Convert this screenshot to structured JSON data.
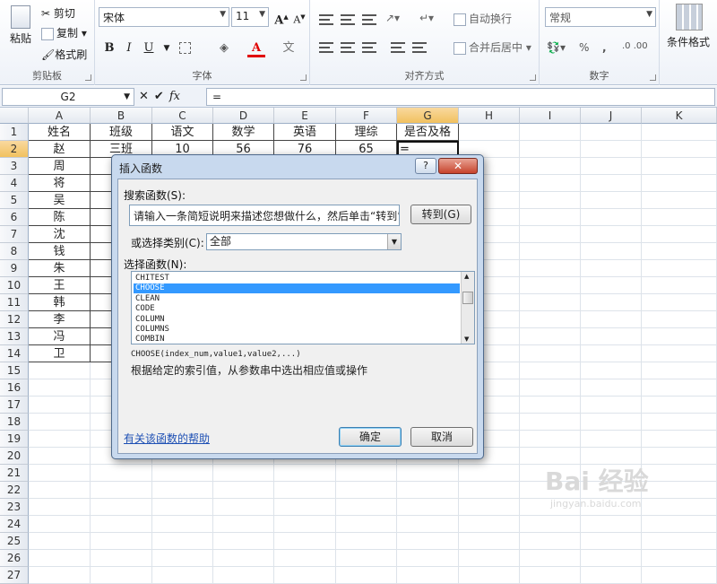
{
  "ribbon": {
    "clipboard": {
      "paste": "粘贴",
      "cut": "剪切",
      "copy": "复制",
      "format_painter": "格式刷",
      "group_label": "剪贴板"
    },
    "font": {
      "font_name": "宋体",
      "font_size": "11",
      "grow": "A",
      "shrink": "A",
      "bold": "B",
      "italic": "I",
      "underline": "U",
      "group_label": "字体"
    },
    "alignment": {
      "wrap": "自动换行",
      "merge": "合并后居中",
      "group_label": "对齐方式"
    },
    "number": {
      "format": "常规",
      "percent": "%",
      "comma": ",",
      "group_label": "数字"
    },
    "styles": {
      "conditional": "条件格式"
    }
  },
  "formula_bar": {
    "name_box": "G2",
    "cancel": "✕",
    "enter": "✔",
    "fx": "fx",
    "formula": "="
  },
  "sheet": {
    "columns": [
      "A",
      "B",
      "C",
      "D",
      "E",
      "F",
      "G",
      "H",
      "I",
      "J",
      "K"
    ],
    "rows": [
      "1",
      "2",
      "3",
      "4",
      "5",
      "6",
      "7",
      "8",
      "9",
      "10",
      "11",
      "12",
      "13",
      "14",
      "15",
      "16",
      "17",
      "18",
      "19",
      "20",
      "21",
      "22",
      "23",
      "24",
      "25",
      "26",
      "27"
    ],
    "headers": [
      "姓名",
      "班级",
      "语文",
      "数学",
      "英语",
      "理综",
      "是否及格"
    ],
    "row2": [
      "赵",
      "三班",
      "10",
      "56",
      "76",
      "65",
      "="
    ],
    "names": [
      "周",
      "将",
      "吴",
      "陈",
      "沈",
      "钱",
      "朱",
      "王",
      "韩",
      "李",
      "冯",
      "卫"
    ]
  },
  "dialog": {
    "title": "插入函数",
    "help_button": "?",
    "close_button": "✕",
    "search_label": "搜索函数(S):",
    "search_placeholder": "请输入一条简短说明来描述您想做什么，然后单击“转到”",
    "go_button": "转到(G)",
    "category_label": "或选择类别(C):",
    "category_value": "全部",
    "function_label": "选择函数(N):",
    "functions": [
      "CHITEST",
      "CHOOSE",
      "CLEAN",
      "CODE",
      "COLUMN",
      "COLUMNS",
      "COMBIN"
    ],
    "selected_function": "CHOOSE",
    "signature": "CHOOSE(index_num,value1,value2,...)",
    "description": "根据给定的索引值，从参数串中选出相应值或操作",
    "help_link": "有关该函数的帮助",
    "ok_button": "确定",
    "cancel_button": "取消"
  },
  "watermark": {
    "brand": "Bai 经验",
    "url": "jingyan.baidu.com"
  }
}
